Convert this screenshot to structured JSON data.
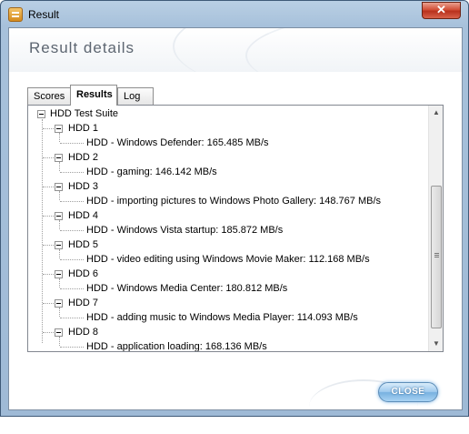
{
  "window": {
    "title": "Result",
    "close_glyph": "✕"
  },
  "header": {
    "title": "Result details"
  },
  "tabs": [
    {
      "label": "Scores",
      "active": false
    },
    {
      "label": "Results",
      "active": true
    },
    {
      "label": "Log",
      "active": false
    }
  ],
  "tree": {
    "root": "HDD Test Suite",
    "groups": [
      {
        "label": "HDD 1",
        "child": "HDD - Windows Defender: 165.485 MB/s"
      },
      {
        "label": "HDD 2",
        "child": "HDD - gaming: 146.142 MB/s"
      },
      {
        "label": "HDD 3",
        "child": "HDD - importing pictures to Windows Photo Gallery: 148.767 MB/s"
      },
      {
        "label": "HDD 4",
        "child": "HDD - Windows Vista startup: 185.872 MB/s"
      },
      {
        "label": "HDD 5",
        "child": "HDD - video editing using Windows Movie Maker: 112.168 MB/s"
      },
      {
        "label": "HDD 6",
        "child": "HDD - Windows Media Center: 180.812 MB/s"
      },
      {
        "label": "HDD 7",
        "child": "HDD - adding music to Windows Media Player: 114.093 MB/s"
      },
      {
        "label": "HDD 8",
        "child": "HDD - application loading: 168.136 MB/s"
      }
    ]
  },
  "scrollbar": {
    "up_glyph": "▲",
    "down_glyph": "▼"
  },
  "footer": {
    "close_label": "CLOSE"
  },
  "colors": {
    "title_bar": "#a7c1db",
    "close_x": "#c9432b",
    "close_button": "#8fc1ea"
  }
}
